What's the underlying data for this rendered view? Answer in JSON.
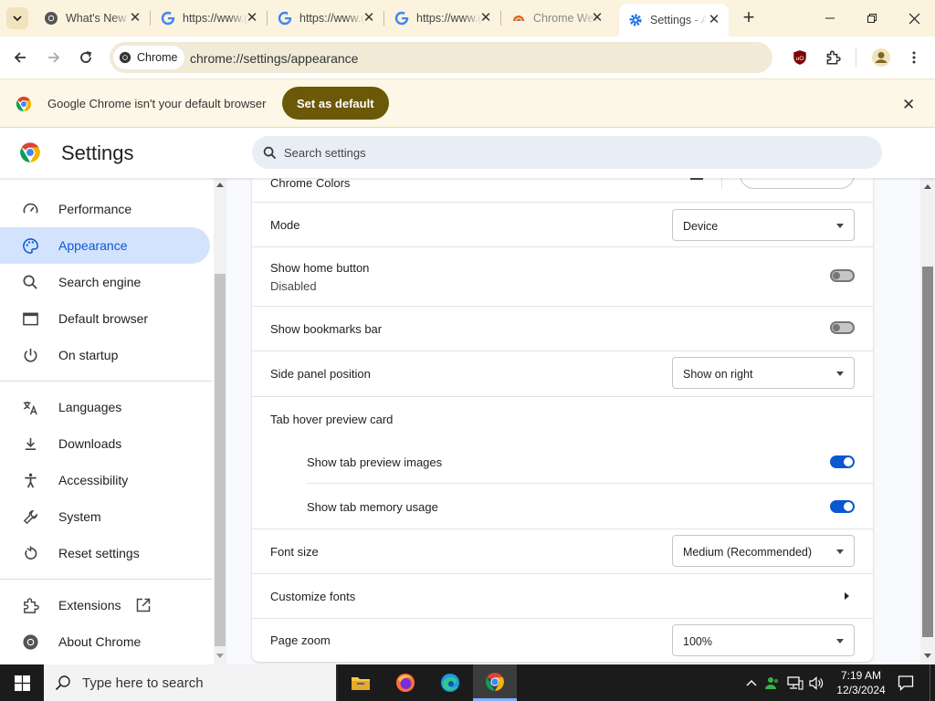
{
  "tabs": [
    {
      "title": "What's New"
    },
    {
      "title": "https://www.google.com"
    },
    {
      "title": "https://www.google.com"
    },
    {
      "title": "https://www.google.com"
    },
    {
      "title": "Chrome Web Store"
    },
    {
      "title": "Settings - Appearance"
    }
  ],
  "toolbar": {
    "site_chip": "Chrome",
    "url": "chrome://settings/appearance"
  },
  "infobar": {
    "message": "Google Chrome isn't your default browser",
    "button": "Set as default"
  },
  "settings": {
    "title": "Settings",
    "search_placeholder": "Search settings"
  },
  "sidebar": {
    "items": [
      {
        "label": "Performance",
        "icon": "performance-gauge-icon"
      },
      {
        "label": "Appearance",
        "icon": "palette-icon",
        "selected": true
      },
      {
        "label": "Search engine",
        "icon": "search-icon"
      },
      {
        "label": "Default browser",
        "icon": "browser-window-icon"
      },
      {
        "label": "On startup",
        "icon": "power-icon"
      },
      {
        "label": "Languages",
        "icon": "translate-icon"
      },
      {
        "label": "Downloads",
        "icon": "download-icon"
      },
      {
        "label": "Accessibility",
        "icon": "accessibility-icon"
      },
      {
        "label": "System",
        "icon": "wrench-icon"
      },
      {
        "label": "Reset settings",
        "icon": "reset-icon"
      },
      {
        "label": "Extensions",
        "icon": "extension-icon"
      },
      {
        "label": "About Chrome",
        "icon": "chrome-logo-icon"
      }
    ]
  },
  "appearance": {
    "chrome_colors": "Chrome Colors",
    "mode_label": "Mode",
    "mode_value": "Device",
    "home_button_label": "Show home button",
    "home_button_sub": "Disabled",
    "home_button_on": false,
    "bookmarks_bar_label": "Show bookmarks bar",
    "bookmarks_bar_on": false,
    "side_panel_label": "Side panel position",
    "side_panel_value": "Show on right",
    "tab_hover_label": "Tab hover preview card",
    "tab_preview_images_label": "Show tab preview images",
    "tab_preview_images_on": true,
    "tab_memory_label": "Show tab memory usage",
    "tab_memory_on": true,
    "font_size_label": "Font size",
    "font_size_value": "Medium (Recommended)",
    "customize_fonts_label": "Customize fonts",
    "page_zoom_label": "Page zoom",
    "page_zoom_value": "100%"
  },
  "taskbar": {
    "search_placeholder": "Type here to search",
    "time": "7:19 AM",
    "date": "12/3/2024"
  },
  "colors": {
    "accent": "#0b57d0",
    "selected_nav_bg": "#d3e3fd",
    "infobar_button": "#6b5809",
    "tabstrip_bg": "#fbf3dd"
  }
}
